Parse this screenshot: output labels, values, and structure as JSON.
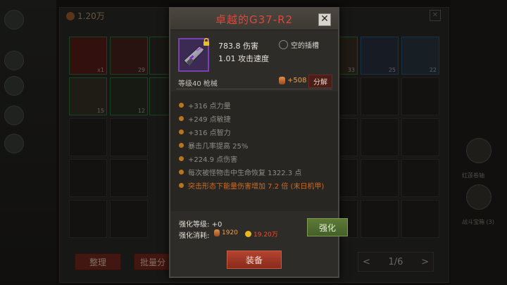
{
  "background": {
    "currency": "1.20万",
    "slots_row1_counts": [
      "x1",
      "29",
      "",
      "",
      "",
      "",
      "33",
      "25",
      "22"
    ],
    "slots_row2_counts": [
      "15",
      "12"
    ],
    "sort_label": "整理",
    "bulk_label": "批量分",
    "page": "1/6",
    "prev": "<",
    "next": ">",
    "right_texts": [
      "红莲卷轴",
      "战斗宝箱 (3)"
    ]
  },
  "item": {
    "title": "卓越的G37-R2",
    "close": "✕",
    "damage": "783.8 伤害",
    "attack_speed": "1.01 攻击速度",
    "socket_label": "空的插槽",
    "level_type": "等级40  枪械",
    "salvage_value": "+508",
    "salvage_label": "分解",
    "rarity_color": "#7c3fb0",
    "affixes": [
      "+316 点力量",
      "+249 点敏捷",
      "+316 点智力",
      "暴击几率提高 25%",
      "+224.9 点伤害",
      "每次被怪物击中生命恢复 1322.3 点"
    ],
    "special_affix": "突击形态下能量伤害增加 7.2 倍 (末日机甲)",
    "enhance_level_label": "强化等级:",
    "enhance_level_value": "+0",
    "enhance_cost_label": "强化消耗:",
    "enhance_cost_gem": "1920",
    "enhance_cost_gold": "19.20万",
    "enhance_button": "强化",
    "equip_button": "装备"
  }
}
